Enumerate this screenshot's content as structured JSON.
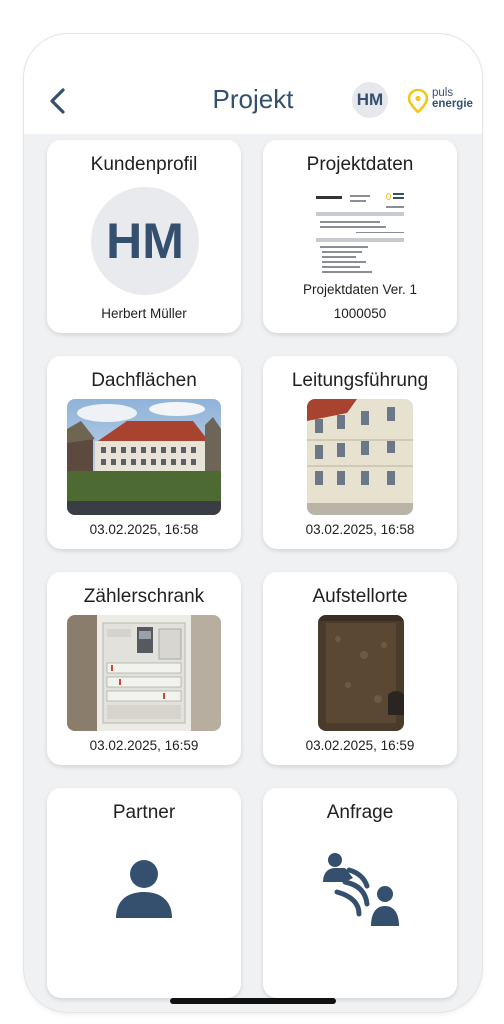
{
  "header": {
    "title": "Projekt",
    "user_initials": "HM",
    "logo_line1": "puls",
    "logo_line2": "energie"
  },
  "cards": {
    "kundenprofil": {
      "title": "Kundenprofil",
      "initials": "HM",
      "name": "Herbert Müller"
    },
    "projektdaten": {
      "title": "Projektdaten",
      "doc_label": "Projektdaten Ver. 1",
      "number": "1000050"
    },
    "dachflaechen": {
      "title": "Dachflächen",
      "timestamp": "03.02.2025, 16:58"
    },
    "leitungsfuehrung": {
      "title": "Leitungsführung",
      "timestamp": "03.02.2025, 16:58"
    },
    "zaehlerschrank": {
      "title": "Zählerschrank",
      "timestamp": "03.02.2025, 16:59"
    },
    "aufstellorte": {
      "title": "Aufstellorte",
      "timestamp": "03.02.2025, 16:59"
    },
    "partner": {
      "title": "Partner"
    },
    "anfrage": {
      "title": "Anfrage"
    }
  },
  "colors": {
    "primary": "#34506e",
    "accent": "#f5c518",
    "background": "#f0f1f3"
  },
  "icons": [
    "back-chevron-icon",
    "puls-energie-logo",
    "person-icon",
    "contact-request-icon"
  ]
}
